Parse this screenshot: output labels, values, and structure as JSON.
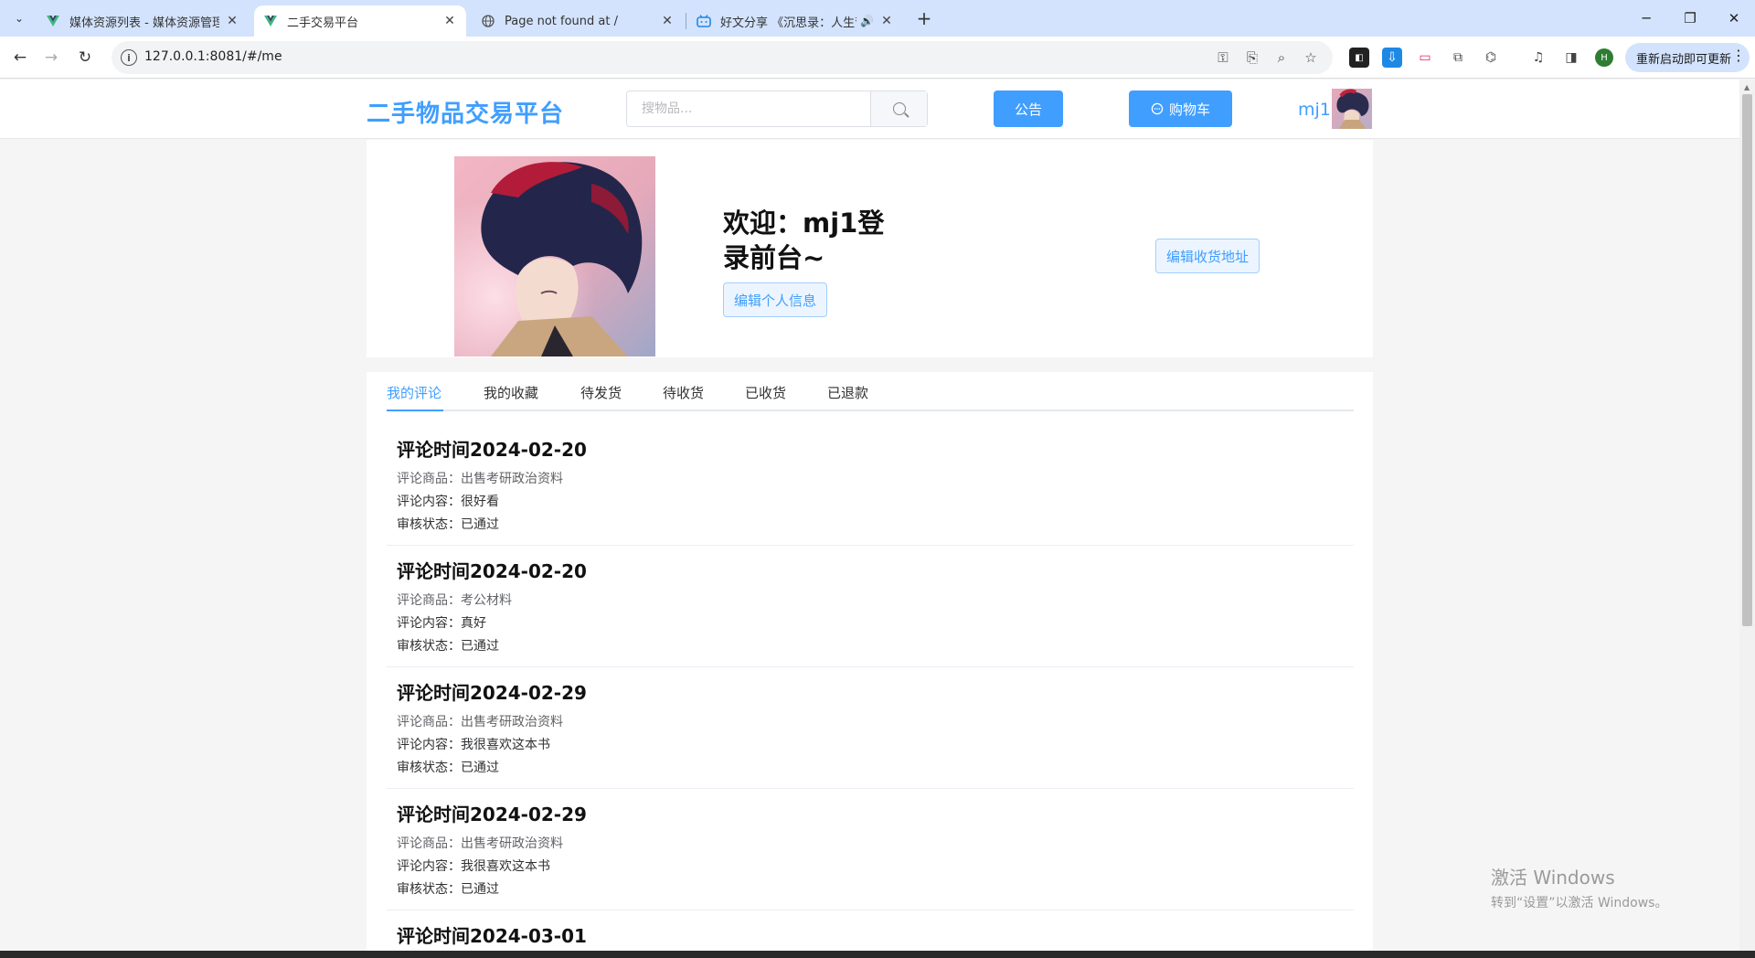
{
  "browser": {
    "tabs": [
      {
        "title": "媒体资源列表 - 媒体资源管理系",
        "favicon": "vue-icon"
      },
      {
        "title": "二手交易平台",
        "favicon": "vue-icon",
        "active": true
      },
      {
        "title": "Page not found at /",
        "favicon": "globe-icon"
      },
      {
        "title": "好文分享 《沉思录：人生哲",
        "favicon": "bilibili-icon"
      }
    ],
    "new_tab": "+",
    "url": "127.0.0.1:8081/#/me",
    "relaunch_label": "重新启动即可更新",
    "profile_initial": "H"
  },
  "header": {
    "logo": "二手物品交易平台",
    "search_placeholder": "搜物品...",
    "notice_label": "公告",
    "cart_label": "购物车",
    "username": "mj1"
  },
  "profile": {
    "welcome": "欢迎：mj1登录前台~",
    "edit_info_label": "编辑个人信息",
    "edit_address_label": "编辑收货地址"
  },
  "tabs": [
    {
      "label": "我的评论",
      "active": true
    },
    {
      "label": "我的收藏"
    },
    {
      "label": "待发货"
    },
    {
      "label": "待收货"
    },
    {
      "label": "已收货"
    },
    {
      "label": "已退款"
    }
  ],
  "comments": [
    {
      "title": "评论时间2024-02-20",
      "product": "评论商品：出售考研政治资料",
      "content": "评论内容：很好看",
      "status": "审核状态：已通过"
    },
    {
      "title": "评论时间2024-02-20",
      "product": "评论商品：考公材料",
      "content": "评论内容：真好",
      "status": "审核状态：已通过"
    },
    {
      "title": "评论时间2024-02-29",
      "product": "评论商品：出售考研政治资料",
      "content": "评论内容：我很喜欢这本书",
      "status": "审核状态：已通过"
    },
    {
      "title": "评论时间2024-02-29",
      "product": "评论商品：出售考研政治资料",
      "content": "评论内容：我很喜欢这本书",
      "status": "审核状态：已通过"
    },
    {
      "title": "评论时间2024-03-01",
      "product": "",
      "content": "",
      "status": ""
    }
  ],
  "watermark": {
    "line1": "激活 Windows",
    "line2": "转到“设置”以激活 Windows。"
  },
  "colors": {
    "accent": "#409eff",
    "tabstrip": "#d3e3fd"
  }
}
